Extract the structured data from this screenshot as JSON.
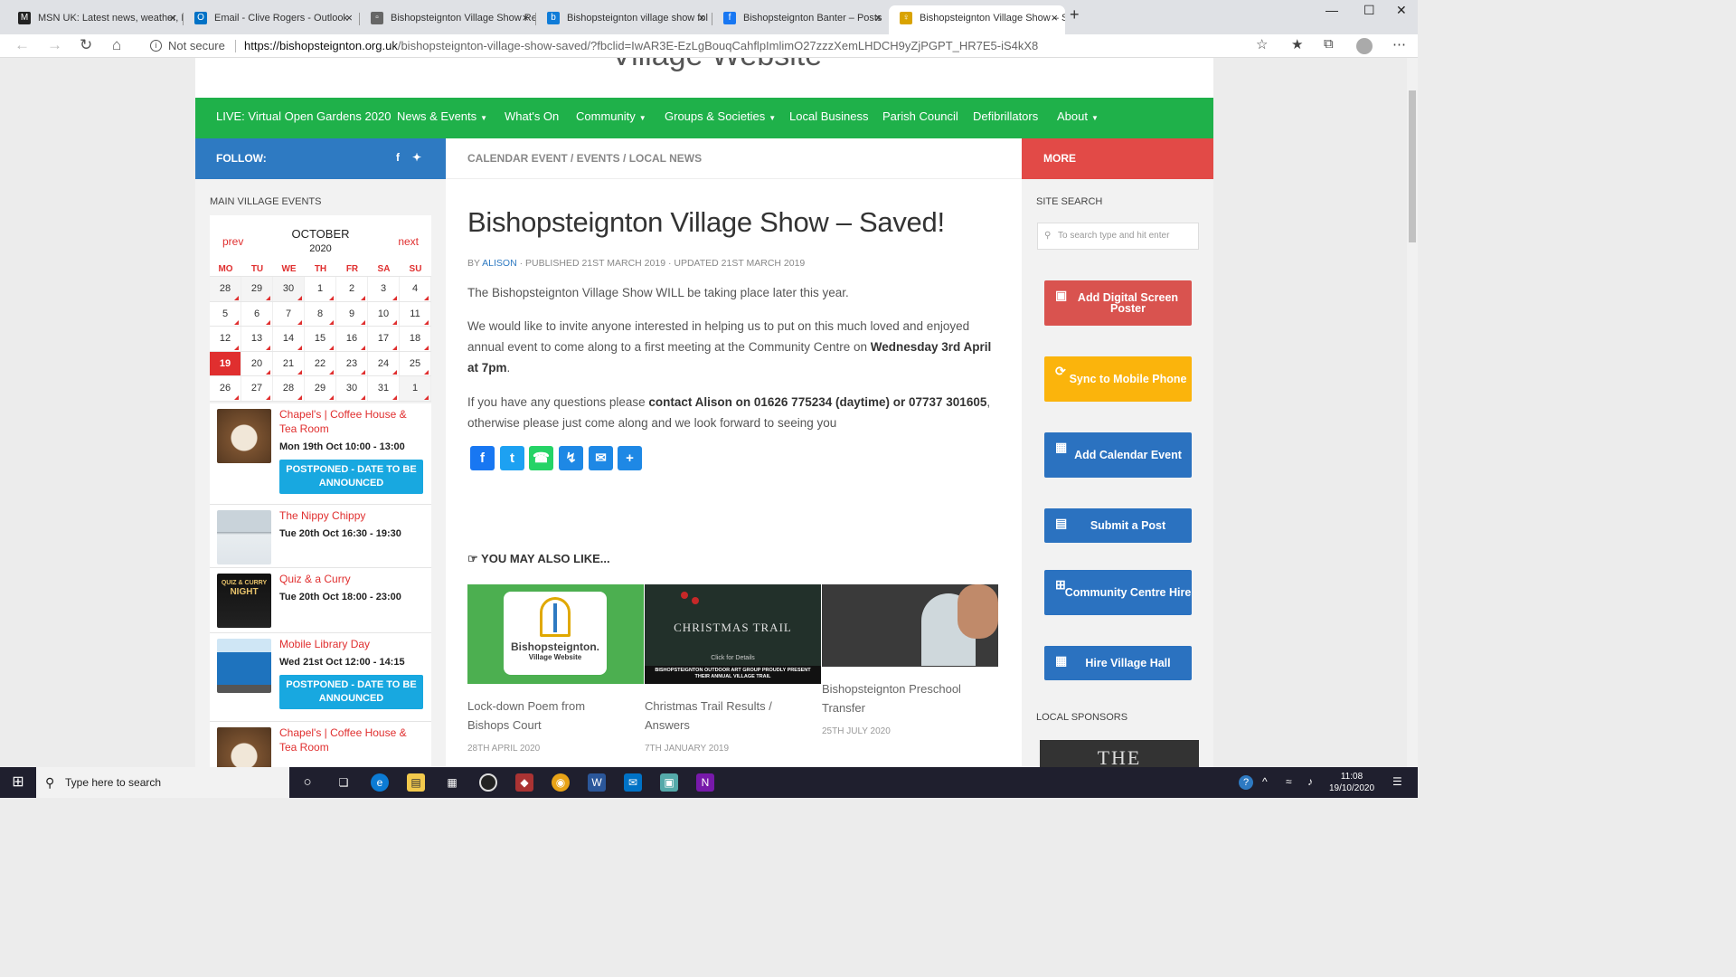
{
  "browser": {
    "tabs": [
      {
        "title": "MSN UK: Latest news, weather, H",
        "icon": "msn-icon",
        "color": "#222222"
      },
      {
        "title": "Email - Clive Rogers - Outlook",
        "icon": "outlook-icon",
        "color": "#0072c6"
      },
      {
        "title": "Bishopsteignton Village Show Re",
        "icon": "page-icon",
        "color": "#666666"
      },
      {
        "title": "Bishopsteignton village show fol",
        "icon": "bing-icon",
        "color": "#0f7cd8"
      },
      {
        "title": "Bishopsteignton Banter – Posts",
        "icon": "facebook-icon",
        "color": "#1877f2"
      },
      {
        "title": "Bishopsteignton Village Show – S",
        "icon": "site-icon",
        "color": "#d9a300"
      }
    ],
    "address": {
      "not_secure": "Not secure",
      "url_host": "https://bishopsteignton.org.uk",
      "url_path": "/bishopsteignton-village-show-saved/?fbclid=IwAR3E-EzLgBouqCahflpImlimO27zzzXemLHDCH9yZjPGPT_HR7E5-iS4kX8"
    }
  },
  "site": {
    "nav": [
      {
        "label": "LIVE: Virtual Open Gardens 2020",
        "dropdown": false
      },
      {
        "label": "News & Events",
        "dropdown": true
      },
      {
        "label": "What's On",
        "dropdown": false
      },
      {
        "label": "Community",
        "dropdown": true
      },
      {
        "label": "Groups & Societies",
        "dropdown": true
      },
      {
        "label": "Local Business",
        "dropdown": false
      },
      {
        "label": "Parish Council",
        "dropdown": false
      },
      {
        "label": "Defibrillators",
        "dropdown": false
      },
      {
        "label": "About",
        "dropdown": true
      }
    ],
    "follow_label": "FOLLOW:",
    "breadcrumbs": "CALENDAR EVENT / EVENTS / LOCAL NEWS",
    "more_label": "MORE"
  },
  "left": {
    "heading": "MAIN VILLAGE EVENTS",
    "calendar": {
      "prev": "prev",
      "next": "next",
      "month": "OCTOBER",
      "year": "2020",
      "days": [
        "MO",
        "TU",
        "WE",
        "TH",
        "FR",
        "SA",
        "SU"
      ],
      "weeks": [
        [
          "28",
          "29",
          "30",
          "1",
          "2",
          "3",
          "4"
        ],
        [
          "5",
          "6",
          "7",
          "8",
          "9",
          "10",
          "11"
        ],
        [
          "12",
          "13",
          "14",
          "15",
          "16",
          "17",
          "18"
        ],
        [
          "19",
          "20",
          "21",
          "22",
          "23",
          "24",
          "25"
        ],
        [
          "26",
          "27",
          "28",
          "29",
          "30",
          "31",
          "1"
        ]
      ],
      "today": "19"
    },
    "events": [
      {
        "title": "Chapel's | Coffee House & Tea Room",
        "time": "Mon 19th Oct 10:00 - 13:00",
        "status": "POSTPONED - DATE TO BE ANNOUNCED"
      },
      {
        "title": "The Nippy Chippy",
        "time": "Tue 20th Oct 16:30 - 19:30",
        "status": ""
      },
      {
        "title": "Quiz & a Curry",
        "time": "Tue 20th Oct 18:00 - 23:00",
        "status": ""
      },
      {
        "title": "Mobile Library Day",
        "time": "Wed 21st Oct 12:00 - 14:15",
        "status": "POSTPONED - DATE TO BE ANNOUNCED"
      },
      {
        "title": "Chapel's | Coffee House & Tea Room",
        "time": "",
        "status": ""
      }
    ]
  },
  "article": {
    "title": "Bishopsteignton Village Show – Saved!",
    "meta_by": "BY ",
    "author": "ALISON",
    "meta_dates": " · PUBLISHED 21ST MARCH 2019 · UPDATED 21ST MARCH 2019",
    "p1": "The Bishopsteignton Village Show WILL be taking place later this year.",
    "p2a": "We would like to invite anyone interested in helping us to put on this much loved and enjoyed annual event to come along to a first meeting at the Community Centre on ",
    "p2b": "Wednesday 3rd April at 7pm",
    "p2c": ".",
    "p3a": "If you have any questions please ",
    "p3b": "contact Alison on 01626 775234 (daytime) or 07737 301605",
    "p3c": ", otherwise please just come along and we look forward to seeing you",
    "also_like": "YOU MAY ALSO LIKE...",
    "related": [
      {
        "caption": "Lock-down Poem from Bishops Court",
        "date": "28TH APRIL 2020",
        "logo_text": "Bishopsteignton.",
        "logo_sub": "Village Website"
      },
      {
        "caption": "Christmas Trail Results / Answers",
        "date": "7TH JANUARY 2019",
        "img_title": "CHRISTMAS TRAIL",
        "img_sub": "Click for Details",
        "img_band": "BISHOPSTEIGNTON OUTDOOR ART GROUP PROUDLY PRESENT THEIR ANNUAL VILLAGE TRAIL"
      },
      {
        "caption": "Bishopsteignton Preschool Transfer",
        "date": "25TH JULY 2020"
      }
    ]
  },
  "right": {
    "search_heading": "SITE SEARCH",
    "search_placeholder": "To search type and hit enter",
    "buttons": [
      {
        "label": "Add Digital Screen Poster",
        "color": "#d9534f",
        "icon": "image-icon"
      },
      {
        "label": "Sync to Mobile Phone",
        "color": "#fbb40c",
        "icon": "sync-icon"
      },
      {
        "label": "Add Calendar Event",
        "color": "#2b72c0",
        "icon": "calendar-icon"
      },
      {
        "label": "Submit a Post",
        "color": "#2b72c0",
        "icon": "post-icon"
      },
      {
        "label": "Community Centre Hire",
        "color": "#2b72c0",
        "icon": "calendar-plus-icon"
      },
      {
        "label": "Hire Village Hall",
        "color": "#2b72c0",
        "icon": "calendar-grid-icon"
      }
    ],
    "sponsors_heading": "LOCAL SPONSORS",
    "sponsor_text": "THE"
  },
  "taskbar": {
    "search_placeholder": "Type here to search",
    "time": "11:08",
    "date": "19/10/2020"
  }
}
